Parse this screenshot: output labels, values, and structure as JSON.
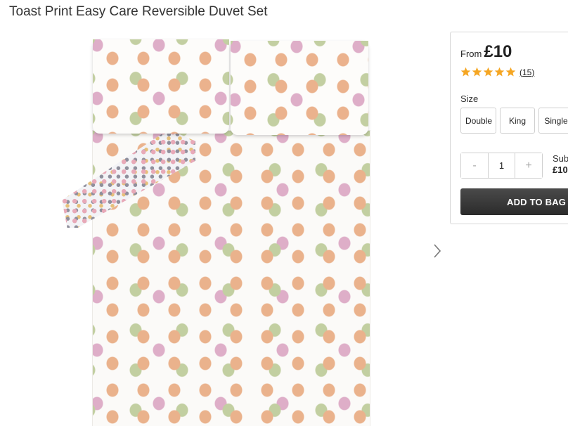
{
  "product": {
    "title": "Toast Print Easy Care Reversible Duvet Set",
    "image_alt": "Toast Print Easy Care Reversible Duvet Set"
  },
  "carousel": {
    "next_icon": "chevron-right-icon"
  },
  "panel": {
    "price_prefix": "From",
    "price": "£10",
    "rating": 5,
    "rating_max": 5,
    "star_color": "#f5a623",
    "review_count": "15",
    "review_open": "(",
    "review_close": ")",
    "size_label": "Size",
    "sizes": [
      "Double",
      "King",
      "Single"
    ],
    "quantity": {
      "decrement": "-",
      "value": "1",
      "increment": "+"
    },
    "subtotal_label": "Subtotal",
    "subtotal_value": "£10",
    "add_to_bag": "ADD TO BAG",
    "button_color": "#333333"
  }
}
